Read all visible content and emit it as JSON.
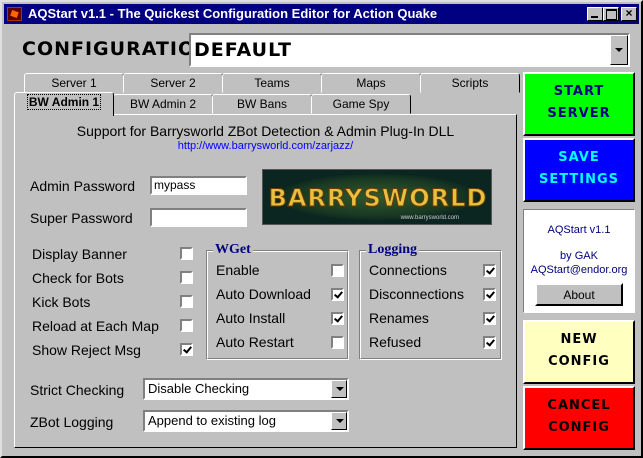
{
  "window": {
    "title": "AQStart v1.1 - The Quickest Configuration Editor for Action Quake",
    "minimize": "",
    "maximize": "",
    "close": "×"
  },
  "config": {
    "label": "CONFIGURATION",
    "value": "DEFAULT"
  },
  "tabs": {
    "row1": [
      "Server 1",
      "Server 2",
      "Teams",
      "Maps",
      "Scripts"
    ],
    "row2": [
      "BW Admin 1",
      "BW Admin 2",
      "BW Bans",
      "Game Spy"
    ],
    "active": "BW Admin 1"
  },
  "panel": {
    "title": "Support for Barrysworld ZBot Detection & Admin Plug-In DLL",
    "url": "http://www.barrysworld.com/zarjazz/",
    "admin_password_label": "Admin Password",
    "admin_password_value": "mypass",
    "super_password_label": "Super Password",
    "super_password_value": "",
    "banner": {
      "word": "BARRYSWORLD",
      "sub": "www.barrysworld.com"
    },
    "left_options": [
      {
        "label": "Display Banner",
        "checked": false
      },
      {
        "label": "Check for Bots",
        "checked": false
      },
      {
        "label": "Kick Bots",
        "checked": false
      },
      {
        "label": "Reload at Each Map",
        "checked": false
      },
      {
        "label": "Show Reject Msg",
        "checked": true
      }
    ],
    "wget": {
      "title": "WGet",
      "options": [
        {
          "label": "Enable",
          "checked": false
        },
        {
          "label": "Auto Download",
          "checked": true
        },
        {
          "label": "Auto Install",
          "checked": true
        },
        {
          "label": "Auto Restart",
          "checked": false
        }
      ]
    },
    "logging": {
      "title": "Logging",
      "options": [
        {
          "label": "Connections",
          "checked": true
        },
        {
          "label": "Disconnections",
          "checked": true
        },
        {
          "label": "Renames",
          "checked": true
        },
        {
          "label": "Refused",
          "checked": true
        }
      ]
    },
    "strict_checking_label": "Strict Checking",
    "strict_checking_value": "Disable Checking",
    "zbot_logging_label": "ZBot Logging",
    "zbot_logging_value": "Append to existing log"
  },
  "side": {
    "start_line1": "START",
    "start_line2": "SERVER",
    "save_line1": "SAVE",
    "save_line2": "SETTINGS",
    "info_name": "AQStart v1.1",
    "info_by": "by GAK",
    "info_email": "AQStart@endor.org",
    "about": "About",
    "new_line1": "NEW",
    "new_line2": "CONFIG",
    "cancel_line1": "CANCEL",
    "cancel_line2": "CONFIG"
  },
  "colors": {
    "title_bar": "#000080",
    "start": "#00ff00",
    "save": "#0000ff",
    "new": "#ffffc0",
    "cancel": "#ff0000",
    "link": "#0000ff",
    "group_title": "#000080"
  }
}
